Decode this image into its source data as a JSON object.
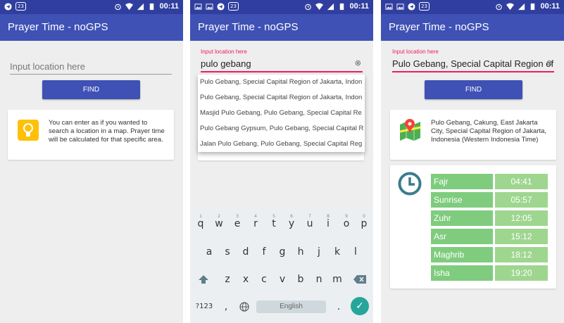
{
  "status": {
    "badge": "23",
    "time": "00:11"
  },
  "app_title": "Prayer Time - noGPS",
  "screen1": {
    "input_placeholder": "Input location here",
    "find_label": "FIND",
    "hint": "You can enter as if you wanted to search a location in a map. Prayer time will be calculated for that specific area."
  },
  "screen2": {
    "float_label": "Input location here",
    "input_value": "pulo gebang",
    "suggestions": [
      "Pulo Gebang, Special Capital Region of Jakarta, Indon",
      "Pulo Gebang, Special Capital Region of Jakarta, Indon",
      "Masjid Pulo Gebang, Pulo Gebang, Special Capital Re",
      "Pulo Gebang Gypsum, Pulo Gebang, Special Capital R",
      "Jalan Pulo Gebang, Pulo Gebang, Special Capital Reg"
    ],
    "keyboard": {
      "row1": [
        "q",
        "w",
        "e",
        "r",
        "t",
        "y",
        "u",
        "i",
        "o",
        "p"
      ],
      "row1_nums": [
        "1",
        "2",
        "3",
        "4",
        "5",
        "6",
        "7",
        "8",
        "9",
        "0"
      ],
      "row2": [
        "a",
        "s",
        "d",
        "f",
        "g",
        "h",
        "j",
        "k",
        "l"
      ],
      "row3": [
        "z",
        "x",
        "c",
        "v",
        "b",
        "n",
        "m"
      ],
      "symbols_label": "?123",
      "comma": ",",
      "period": ".",
      "space_label": "English"
    }
  },
  "screen3": {
    "float_label": "Input location here",
    "input_value": "Pulo Gebang, Special Capital Region of",
    "find_label": "FIND",
    "location_text": "Pulo Gebang, Cakung, East Jakarta City, Special Capital Region of Jakarta, Indonesia (Western Indonesia Time)",
    "times": [
      {
        "name": "Fajr",
        "time": "04:41"
      },
      {
        "name": "Sunrise",
        "time": "05:57"
      },
      {
        "name": "Zuhr",
        "time": "12:05"
      },
      {
        "name": "Asr",
        "time": "15:12"
      },
      {
        "name": "Maghrib",
        "time": "18:12"
      },
      {
        "name": "Isha",
        "time": "19:20"
      }
    ]
  },
  "colors": {
    "primary": "#3f51b5",
    "primary_dark": "#303f9f",
    "accent": "#e91e63",
    "time_name": "#7fcc7e",
    "time_value": "#9ed68f",
    "clock": "#3a7d8c",
    "bulb": "#ffc107"
  }
}
